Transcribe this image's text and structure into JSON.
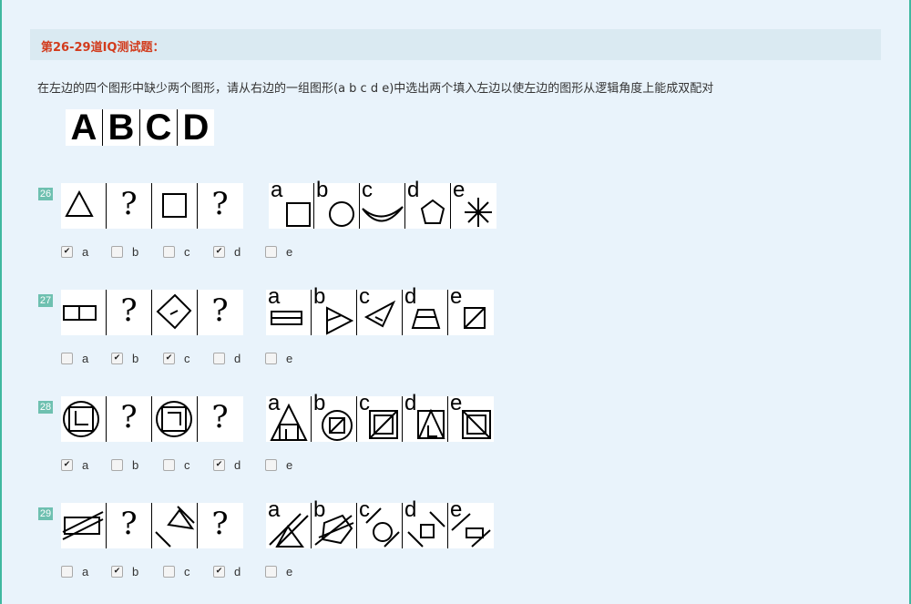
{
  "header": {
    "title": "第26-29道IQ测试题："
  },
  "instruction": "在左边的四个图形中缺少两个图形，请从右边的一组图形(a b c d e)中选出两个填入左边以使左边的图形从逻辑角度上能成双配对",
  "legend": [
    "A",
    "B",
    "C",
    "D"
  ],
  "question_mark": "?",
  "option_labels": [
    "a",
    "b",
    "c",
    "d",
    "e"
  ],
  "questions": [
    {
      "number": "26",
      "checked": [
        true,
        false,
        false,
        true,
        false
      ]
    },
    {
      "number": "27",
      "checked": [
        false,
        true,
        true,
        false,
        false
      ]
    },
    {
      "number": "28",
      "checked": [
        true,
        false,
        false,
        true,
        false
      ]
    },
    {
      "number": "29",
      "checked": [
        false,
        true,
        false,
        true,
        false
      ]
    }
  ],
  "colors": {
    "header_text": "#d23b1c",
    "badge": "#6ec0b0",
    "frame": "#3fb8a0",
    "background": "#e9f3fb"
  }
}
